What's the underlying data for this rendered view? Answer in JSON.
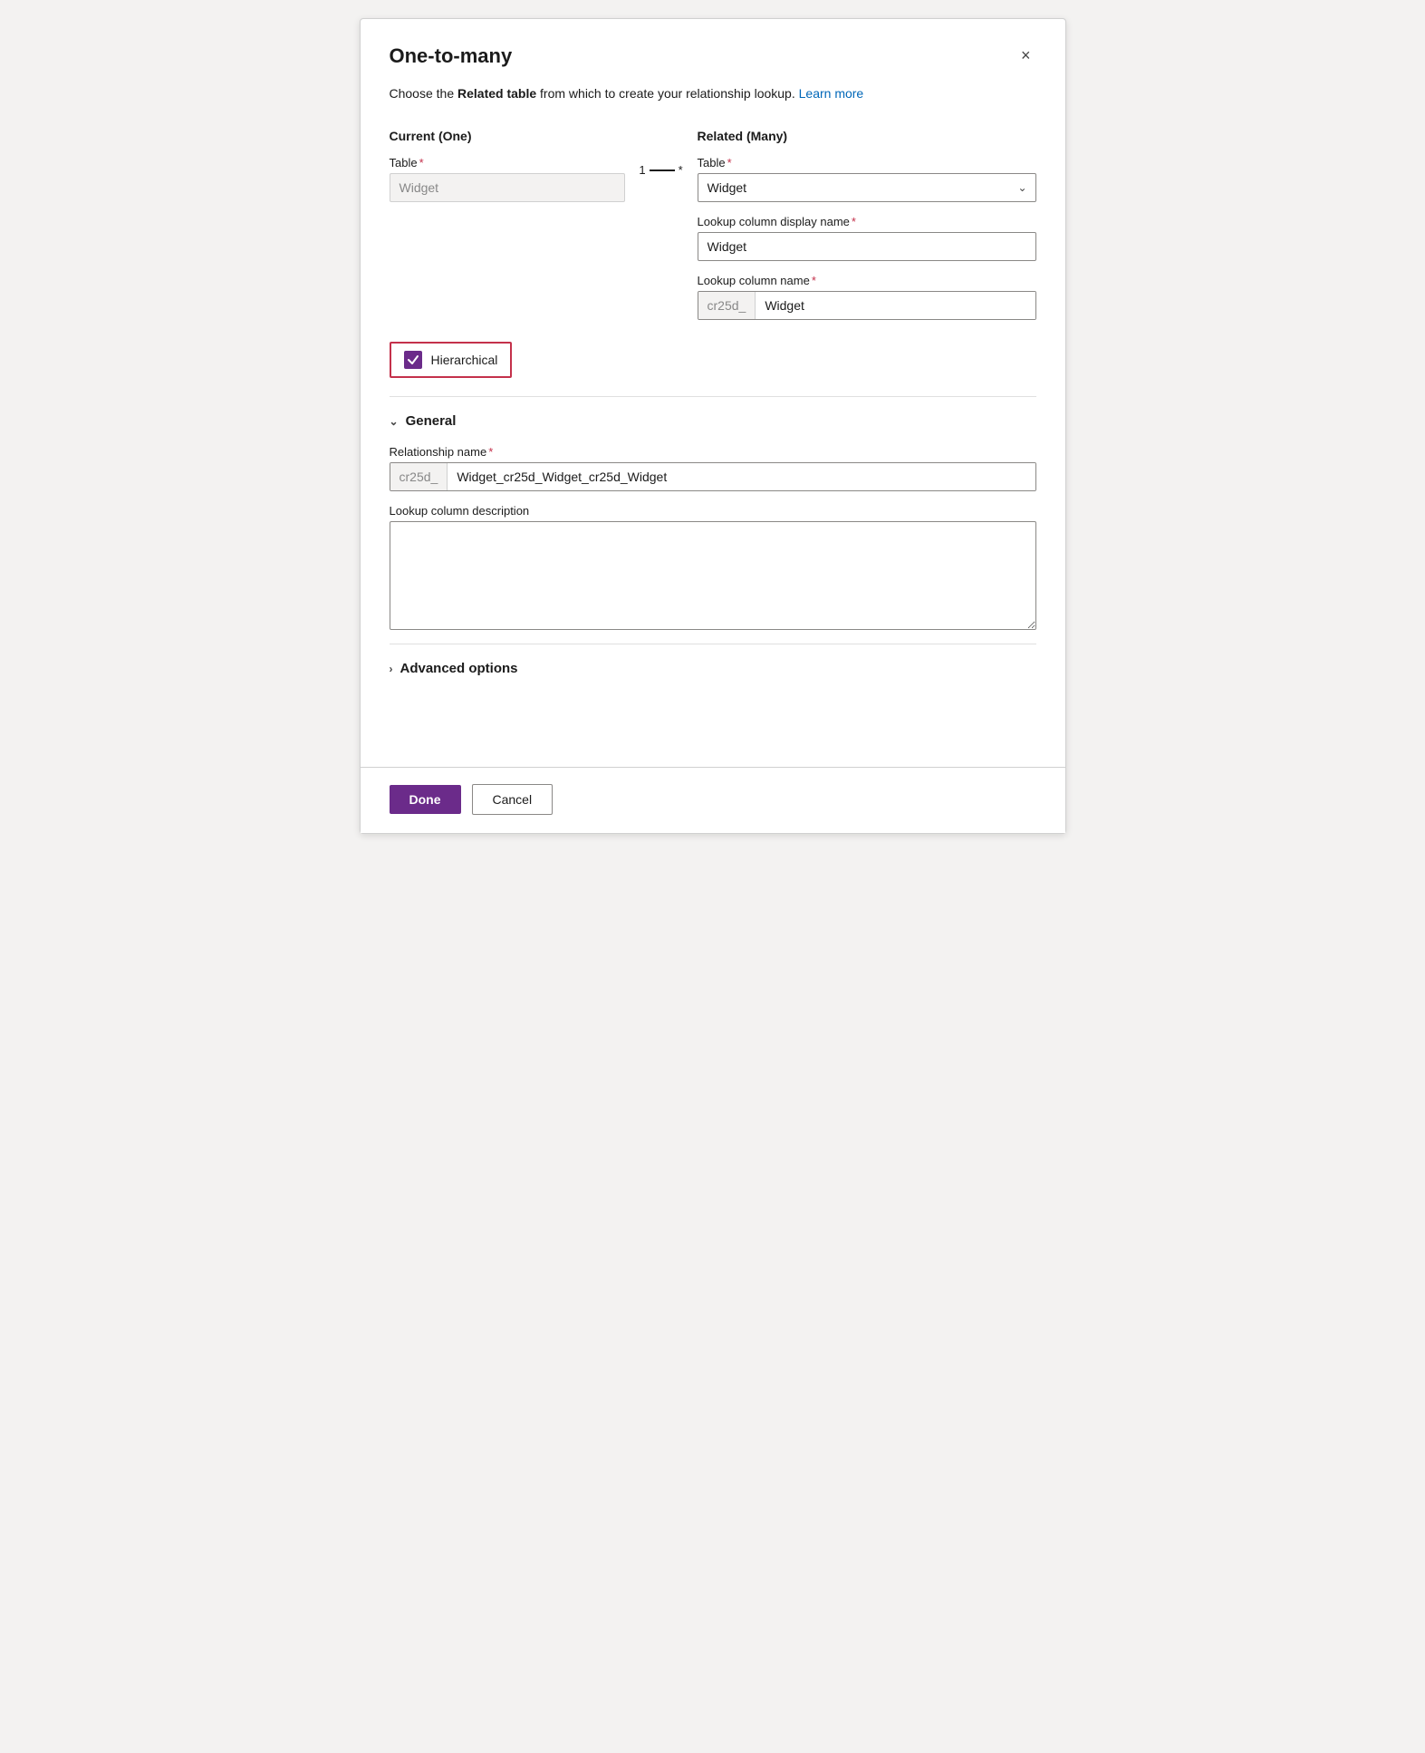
{
  "dialog": {
    "title": "One-to-many",
    "close_label": "×"
  },
  "description": {
    "text_before": "Choose the ",
    "bold_text": "Related table",
    "text_after": " from which to create your relationship lookup.",
    "learn_more_label": "Learn more"
  },
  "current_section": {
    "heading": "Current (One)",
    "table_label": "Table",
    "table_value": "Widget"
  },
  "connector": {
    "left": "1",
    "right": "*"
  },
  "related_section": {
    "heading": "Related (Many)",
    "table_label": "Table",
    "table_value": "Widget",
    "lookup_display_label": "Lookup column display name",
    "lookup_display_value": "Widget",
    "lookup_name_label": "Lookup column name",
    "lookup_name_prefix": "cr25d_",
    "lookup_name_value": "Widget"
  },
  "hierarchical": {
    "label": "Hierarchical",
    "checked": true
  },
  "general_section": {
    "toggle_label": "General",
    "expanded": true
  },
  "relationship_name": {
    "label": "Relationship name",
    "prefix": "cr25d_",
    "value": "Widget_cr25d_Widget_cr25d_Widget"
  },
  "lookup_description": {
    "label": "Lookup column description",
    "placeholder": ""
  },
  "advanced_section": {
    "toggle_label": "Advanced options",
    "expanded": false
  },
  "footer": {
    "done_label": "Done",
    "cancel_label": "Cancel"
  }
}
